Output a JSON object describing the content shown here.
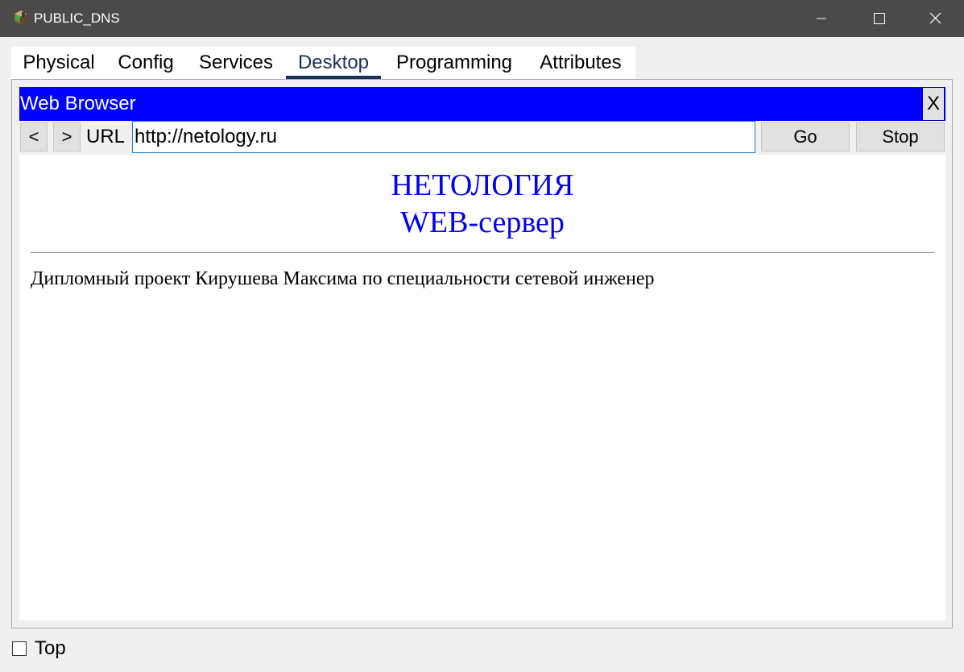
{
  "window": {
    "title": "PUBLIC_DNS",
    "icon": "packet-tracer-server-icon",
    "controls": [
      "minimize-icon",
      "maximize-icon",
      "close-icon"
    ]
  },
  "tabs": [
    {
      "label": "Physical",
      "active": false
    },
    {
      "label": "Config",
      "active": false
    },
    {
      "label": "Services",
      "active": false
    },
    {
      "label": "Desktop",
      "active": true
    },
    {
      "label": "Programming",
      "active": false
    },
    {
      "label": "Attributes",
      "active": false
    }
  ],
  "browser": {
    "title": "Web Browser",
    "close_label": "X",
    "back_label": "<",
    "forward_label": ">",
    "url_label": "URL",
    "url_value": "http://netology.ru",
    "go_label": "Go",
    "stop_label": "Stop",
    "header_color": "#0000ff"
  },
  "page": {
    "heading_line1": "НЕТОЛОГИЯ",
    "heading_line2": "WEB-сервер",
    "heading_color": "#0000ee",
    "body_text": "Дипломный проект Кирушева Максима по специальности сетевой инженер"
  },
  "footer": {
    "top_label": "Top",
    "top_checked": false
  }
}
